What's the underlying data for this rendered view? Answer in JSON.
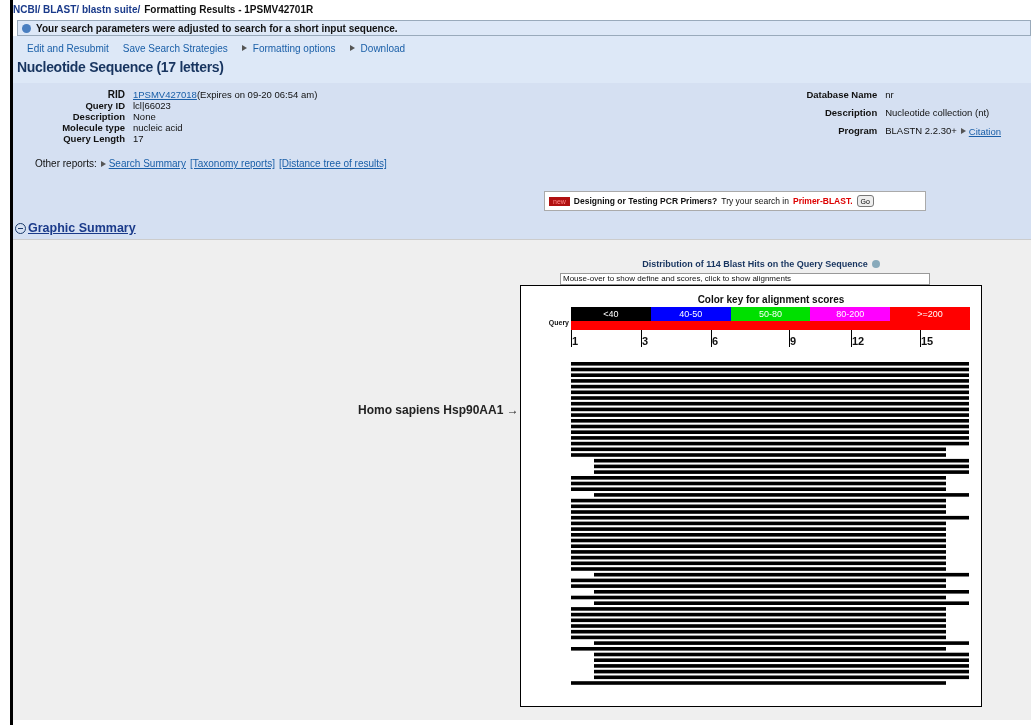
{
  "title_bar": {
    "crumbs": [
      "NCBI/ BLAST/ blastn suite/"
    ],
    "title": "Formatting Results - 1PSMV42701R"
  },
  "notice": "Your search parameters were adjusted to search for a short input sequence.",
  "actions": [
    {
      "label": "Edit and Resubmit",
      "arrow": false
    },
    {
      "label": "Save Search Strategies",
      "arrow": false
    },
    {
      "label": "Formatting options",
      "arrow": true
    },
    {
      "label": "Download",
      "arrow": true
    }
  ],
  "heading": "Nucleotide Sequence (17 letters)",
  "query_info": [
    {
      "label": "RID",
      "value": "1PSMV427018",
      "note": "(Expires on 09-20 06:54 am)",
      "link": true
    },
    {
      "label": "Query ID",
      "value": "lcl|66023",
      "link": false
    },
    {
      "label": "Description",
      "value": "None",
      "link": false
    },
    {
      "label": "Molecule type",
      "value": "nucleic acid",
      "link": false
    },
    {
      "label": "Query Length",
      "value": "17",
      "link": false
    }
  ],
  "db_info": [
    {
      "label": "Database Name",
      "value": "nr"
    },
    {
      "label": "Description",
      "value": "Nucleotide collection (nt)"
    },
    {
      "label": "Program",
      "value": "BLASTN 2.2.30+",
      "link": "Citation"
    }
  ],
  "other_reports": {
    "label": "Other reports:",
    "links": [
      "Search Summary",
      "[Taxonomy reports]",
      "[Distance tree of results]"
    ]
  },
  "primer_banner": {
    "badge": "new",
    "text": "Designing or Testing PCR Primers?",
    "try": "Try your search in",
    "target": "Primer-BLAST.",
    "button": "Go"
  },
  "graphic_summary": {
    "title": "Graphic Summary",
    "expanded": true,
    "distribution_title": "Distribution of 114 Blast Hits on the Query Sequence",
    "hint": "Mouse-over to show define and scores, click to show alignments",
    "key_title": "Color key for alignment scores",
    "key": [
      {
        "label": "<40",
        "color": "#000000"
      },
      {
        "label": "40-50",
        "color": "#0000ff"
      },
      {
        "label": "50-80",
        "color": "#00e000"
      },
      {
        "label": "80-200",
        "color": "#ff00ff"
      },
      {
        "label": ">=200",
        "color": "#ff0000"
      }
    ],
    "query_label": "Query",
    "ticks": [
      "1",
      "3",
      "6",
      "9",
      "12",
      "15"
    ],
    "annotation": "Homo sapiens Hsp90AA1 →"
  }
}
